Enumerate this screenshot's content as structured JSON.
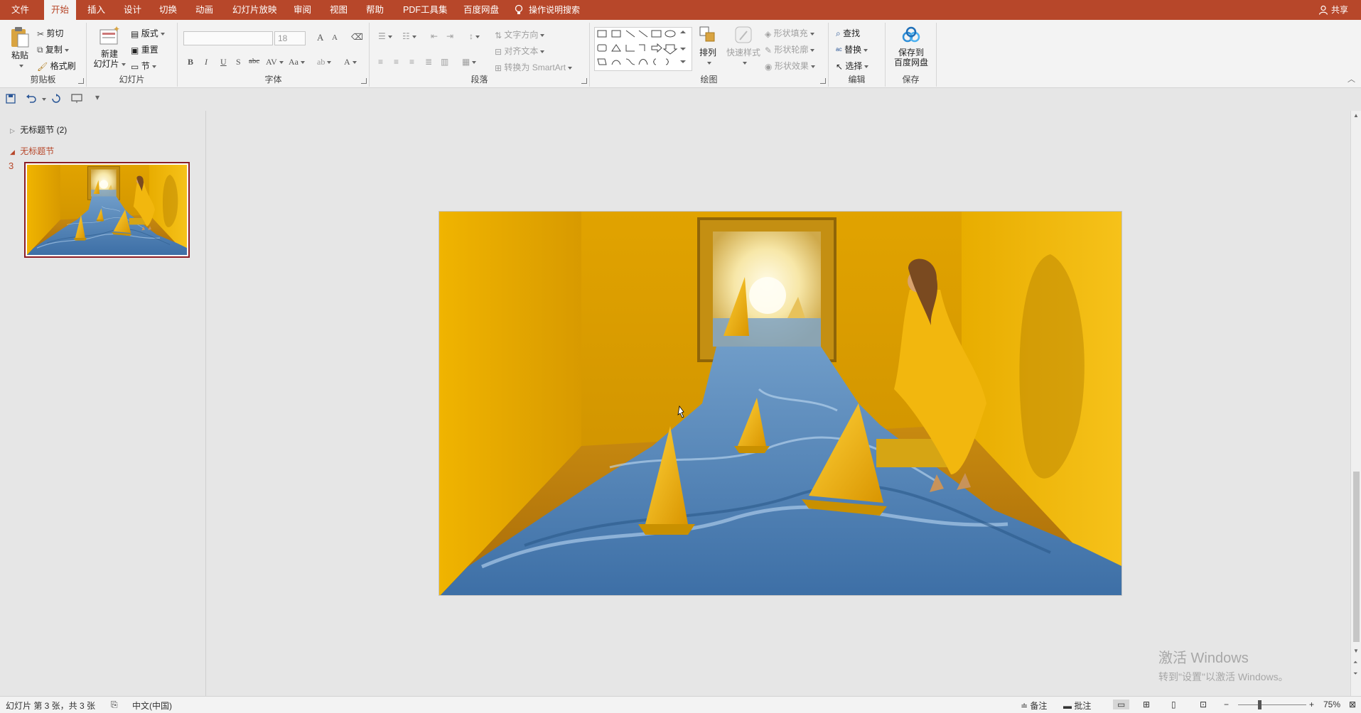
{
  "tabs": {
    "file": "文件",
    "home": "开始",
    "insert": "插入",
    "design": "设计",
    "transitions": "切换",
    "animations": "动画",
    "slideshow": "幻灯片放映",
    "review": "审阅",
    "view": "视图",
    "help": "帮助",
    "pdf_tools": "PDF工具集",
    "baidu": "百度网盘",
    "tell_me": "操作说明搜索",
    "share": "共享"
  },
  "ribbon": {
    "clipboard": {
      "paste": "粘贴",
      "cut": "剪切",
      "copy": "复制",
      "format_painter": "格式刷",
      "label": "剪贴板"
    },
    "slides": {
      "new_slide_line1": "新建",
      "new_slide_line2": "幻灯片",
      "layout": "版式",
      "reset": "重置",
      "section": "节",
      "label": "幻灯片"
    },
    "font": {
      "font_name_value": "",
      "font_size_value": "18",
      "bold": "B",
      "italic": "I",
      "underline": "U",
      "shadow": "S",
      "strike": "abc",
      "spacing": "AV",
      "case": "Aa",
      "grow": "A",
      "shrink": "A",
      "color": "A",
      "label": "字体"
    },
    "paragraph": {
      "text_direction": "文字方向",
      "align_text": "对齐文本",
      "smartart": "转换为 SmartArt",
      "label": "段落"
    },
    "drawing": {
      "arrange": "排列",
      "quick_styles": "快速样式",
      "shape_fill": "形状填充",
      "shape_outline": "形状轮廓",
      "shape_effects": "形状效果",
      "label": "绘图"
    },
    "editing": {
      "find": "查找",
      "replace": "替换",
      "select": "选择",
      "label": "编辑"
    },
    "save": {
      "save_to_line1": "保存到",
      "save_to_line2": "百度网盘",
      "label": "保存"
    }
  },
  "slide_pane": {
    "section1": "无标题节 (2)",
    "section2": "无标题节",
    "slide_number": "3"
  },
  "watermark": {
    "line1": "激活 Windows",
    "line2": "转到\"设置\"以激活 Windows。"
  },
  "status": {
    "slide_info": "幻灯片 第 3 张，共 3 张",
    "language": "中文(中国)",
    "notes": "备注",
    "comments": "批注",
    "zoom": "75%"
  },
  "colors": {
    "accent": "#b7472a",
    "thumb_border": "#8b1c24"
  }
}
